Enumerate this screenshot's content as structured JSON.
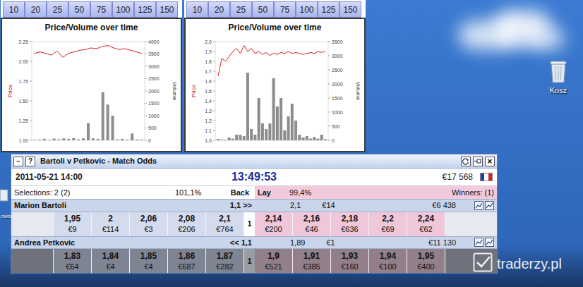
{
  "chart_windows": [
    {
      "toolbar": [
        "10",
        "20",
        "25",
        "50",
        "75",
        "100",
        "125",
        "150"
      ],
      "title": "Price/Volume over time",
      "price_axis": {
        "label": "Price",
        "ticks": [
          "2.25",
          "2.00",
          "1.75",
          "1.50",
          "1.25",
          "1.00"
        ],
        "min": 1.0,
        "max": 2.25
      },
      "volume_axis": {
        "label": "Volume",
        "ticks": [
          "4000",
          "3500",
          "3000",
          "2500",
          "2000",
          "1500",
          "1000",
          "500",
          "0"
        ],
        "max": 4000
      },
      "price": [
        2.1,
        2.12,
        2.1,
        2.08,
        2.13,
        2.05,
        2.1,
        2.12,
        2.14,
        2.15,
        2.17,
        2.16,
        2.19,
        2.2,
        2.17,
        2.15,
        2.16,
        2.14,
        2.12,
        2.1
      ],
      "volume": [
        20,
        30,
        60,
        20,
        70,
        40,
        80,
        60,
        90,
        40,
        80,
        700,
        80,
        60,
        1950,
        1450,
        1000,
        40,
        60,
        30,
        280,
        40,
        30
      ]
    },
    {
      "toolbar": [
        "10",
        "20",
        "25",
        "50",
        "75",
        "100",
        "125",
        "150"
      ],
      "title": "Price/Volume over time",
      "price_axis": {
        "label": "Price",
        "ticks": [
          "2.0",
          "1.9",
          "1.8",
          "1.7",
          "1.6",
          "1.5",
          "1.4",
          "1.3",
          "1.2",
          "1.1",
          "1.0"
        ],
        "min": 1.0,
        "max": 2.0
      },
      "volume_axis": {
        "label": "Volume",
        "ticks": [
          "3500",
          "3000",
          "2500",
          "2000",
          "1500",
          "1000",
          "500",
          "0"
        ],
        "max": 3500
      },
      "price": [
        1.65,
        1.83,
        1.8,
        1.85,
        1.9,
        1.93,
        1.88,
        1.96,
        1.9,
        1.93,
        1.88,
        1.9,
        1.87,
        1.89,
        1.86,
        1.88,
        1.87,
        1.89,
        1.88,
        1.9,
        1.88,
        1.89,
        1.88,
        1.87,
        1.88,
        1.89,
        1.88,
        1.9,
        1.89,
        1.9
      ],
      "volume": [
        50,
        30,
        20,
        100,
        60,
        200,
        200,
        150,
        2400,
        400,
        200,
        1500,
        600,
        400,
        600,
        2200,
        1200,
        1500,
        350,
        850,
        1300,
        700,
        200,
        100,
        150,
        60,
        120,
        60,
        200,
        40
      ]
    }
  ],
  "desktop_icons": [
    {
      "label": "Kosz"
    },
    {
      "label": "owa"
    }
  ],
  "market_window": {
    "title": "Bartoli v Petkovic - Match Odds",
    "title_buttons": [
      "−",
      "?"
    ],
    "close": "×",
    "date": "2011-05-21 14:00",
    "time": "13:49:53",
    "matched": "€17 568",
    "selections": "Selections: 2 (2)",
    "back_percent": "101,1%",
    "back_label": "Back",
    "lay_label": "Lay",
    "lay_percent": "99,4%",
    "winners": "Winners: (1)",
    "runners": [
      {
        "name": "Marion Bartoli",
        "indicator": "1,1 >>",
        "last_price": "2,1",
        "last_amount": "€14",
        "total": "€6 438",
        "shaded": false,
        "mid": "1",
        "back": [
          {
            "price": "1,95",
            "amount": "€9"
          },
          {
            "price": "2",
            "amount": "€114"
          },
          {
            "price": "2,06",
            "amount": "€3"
          },
          {
            "price": "2,08",
            "amount": "€206"
          },
          {
            "price": "2,1",
            "amount": "€764"
          }
        ],
        "lay": [
          {
            "price": "2,14",
            "amount": "€200"
          },
          {
            "price": "2,16",
            "amount": "€46"
          },
          {
            "price": "2,18",
            "amount": "€636"
          },
          {
            "price": "2,2",
            "amount": "€69"
          },
          {
            "price": "2,24",
            "amount": "€62"
          }
        ]
      },
      {
        "name": "Andrea Petkovic",
        "indicator": "<< 1,1",
        "last_price": "1,89",
        "last_amount": "€1",
        "total": "€11 130",
        "shaded": true,
        "mid": "1",
        "back": [
          {
            "price": "1,83",
            "amount": "€64"
          },
          {
            "price": "1,84",
            "amount": "€4"
          },
          {
            "price": "1,85",
            "amount": "€4"
          },
          {
            "price": "1,86",
            "amount": "€687"
          },
          {
            "price": "1,87",
            "amount": "€282"
          }
        ],
        "lay": [
          {
            "price": "1,9",
            "amount": "€521"
          },
          {
            "price": "1,91",
            "amount": "€385"
          },
          {
            "price": "1,93",
            "amount": "€160"
          },
          {
            "price": "1,94",
            "amount": "€100"
          },
          {
            "price": "1,95",
            "amount": "€400"
          }
        ]
      }
    ]
  },
  "watermark": {
    "text": "traderzy.pl"
  }
}
